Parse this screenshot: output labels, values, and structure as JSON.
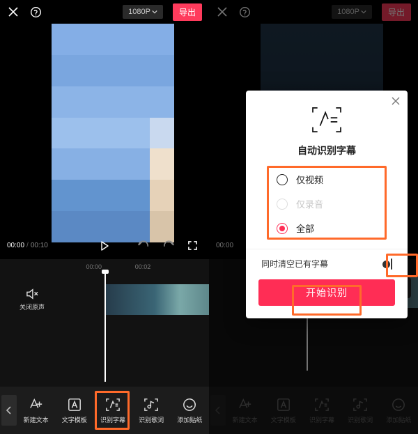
{
  "header": {
    "resolution": "1080P",
    "export": "导出"
  },
  "transport": {
    "current": "00:00",
    "total": "00:10"
  },
  "ruler": {
    "t0": "00:00",
    "t1": "00:02"
  },
  "mute": {
    "label": "关闭原声"
  },
  "toolbar": {
    "items": [
      {
        "label": "新建文本"
      },
      {
        "label": "文字模板"
      },
      {
        "label": "识别字幕"
      },
      {
        "label": "识别歌词"
      },
      {
        "label": "添加贴纸"
      }
    ]
  },
  "modal": {
    "title": "自动识别字幕",
    "options": [
      {
        "label": "仅视频",
        "state": "unselected"
      },
      {
        "label": "仅录音",
        "state": "disabled"
      },
      {
        "label": "全部",
        "state": "selected"
      }
    ],
    "clear_label": "同时清空已有字幕",
    "submit": "开始识别"
  }
}
